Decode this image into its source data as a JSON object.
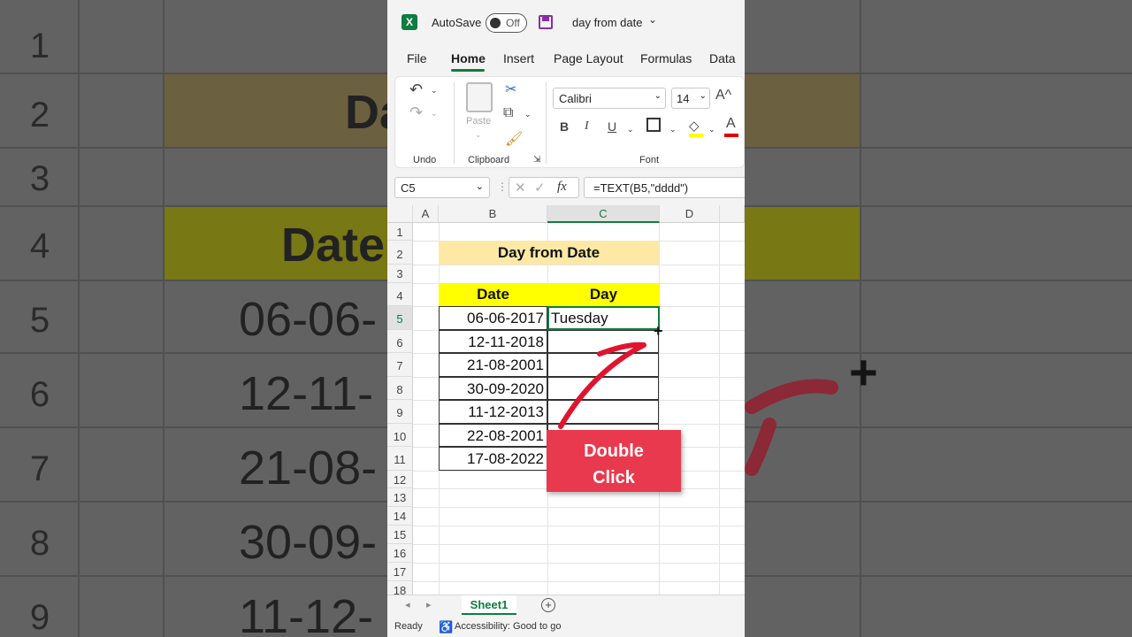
{
  "app": {
    "autosave_label": "AutoSave",
    "autosave_state": "Off",
    "doc_title": "day from date"
  },
  "tabs": [
    "File",
    "Home",
    "Insert",
    "Page Layout",
    "Formulas",
    "Data"
  ],
  "active_tab": "Home",
  "ribbon": {
    "undo_group": "Undo",
    "clipboard_group": "Clipboard",
    "paste_label": "Paste",
    "font_group": "Font",
    "font_name": "Calibri",
    "font_size": "14",
    "bold": "B",
    "italic": "I",
    "underline": "U",
    "font_color_glyph": "A"
  },
  "formula_bar": {
    "name_box": "C5",
    "fx": "fx",
    "formula": "=TEXT(B5,\"dddd\")"
  },
  "grid": {
    "columns": [
      "A",
      "B",
      "C",
      "D"
    ],
    "rows": [
      "1",
      "2",
      "3",
      "4",
      "5",
      "6",
      "7",
      "8",
      "9",
      "10",
      "11",
      "12",
      "13",
      "14",
      "15",
      "16",
      "17",
      "18"
    ],
    "title": "Day from Date",
    "header_date": "Date",
    "header_day": "Day",
    "dates": [
      "06-06-2017",
      "12-11-2018",
      "21-08-2001",
      "30-09-2020",
      "11-12-2013",
      "22-08-2001",
      "17-08-2022"
    ],
    "days": [
      "Tuesday",
      "",
      "",
      "",
      "",
      "",
      ""
    ]
  },
  "sheet_tab": "Sheet1",
  "status": {
    "ready": "Ready",
    "accessibility": "Accessibility: Good to go"
  },
  "callout": {
    "line1": "Double",
    "line2": "Click"
  },
  "background": {
    "row_numbers": [
      "1",
      "2",
      "3",
      "4",
      "5",
      "6",
      "7",
      "8",
      "9"
    ],
    "title_fragment": "Da",
    "header_fragment": "Date",
    "date_fragments": [
      "06-06-",
      "12-11-",
      "21-08-",
      "30-09-",
      "11-12-"
    ]
  },
  "colors": {
    "excel_green": "#107c41",
    "title_fill": "#fde9a5",
    "header_fill": "#ffff00",
    "callout_red": "#e8394e"
  }
}
